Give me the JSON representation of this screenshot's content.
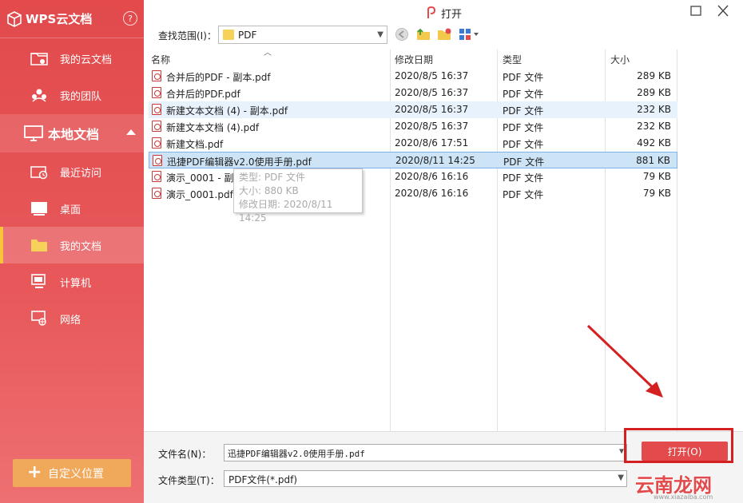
{
  "sidebar": {
    "brand": "WPS云文档",
    "help": "?",
    "items_top": [
      {
        "label": "我的云文档",
        "icon": "cloud-folder-icon"
      },
      {
        "label": "我的团队",
        "icon": "team-icon"
      }
    ],
    "section": "本地文档",
    "items_local": [
      {
        "label": "最近访问",
        "icon": "recent-icon"
      },
      {
        "label": "桌面",
        "icon": "desktop-icon"
      },
      {
        "label": "我的文档",
        "icon": "folder-icon"
      },
      {
        "label": "计算机",
        "icon": "computer-icon"
      },
      {
        "label": "网络",
        "icon": "network-icon"
      }
    ],
    "custom_button": "自定义位置"
  },
  "dialog": {
    "title": "打开",
    "look_in_label": "查找范围(I)：",
    "look_in_value": "PDF"
  },
  "columns": {
    "name": "名称",
    "date": "修改日期",
    "type": "类型",
    "size": "大小"
  },
  "files": [
    {
      "name": "合并后的PDF - 副本.pdf",
      "date": "2020/8/5 16:37",
      "type": "PDF 文件",
      "size": "289 KB"
    },
    {
      "name": "合并后的PDF.pdf",
      "date": "2020/8/5 16:37",
      "type": "PDF 文件",
      "size": "289 KB"
    },
    {
      "name": "新建文本文档 (4) - 副本.pdf",
      "date": "2020/8/5 16:37",
      "type": "PDF 文件",
      "size": "232 KB"
    },
    {
      "name": "新建文本文档 (4).pdf",
      "date": "2020/8/5 16:37",
      "type": "PDF 文件",
      "size": "232 KB"
    },
    {
      "name": "新建文档.pdf",
      "date": "2020/8/6 17:51",
      "type": "PDF 文件",
      "size": "492 KB"
    },
    {
      "name": "迅捷PDF编辑器v2.0使用手册.pdf",
      "date": "2020/8/11 14:25",
      "type": "PDF 文件",
      "size": "881 KB"
    },
    {
      "name": "演示_0001 - 副本.pdf",
      "date": "2020/8/6 16:16",
      "type": "PDF 文件",
      "size": "79 KB"
    },
    {
      "name": "演示_0001.pdf",
      "date": "2020/8/6 16:16",
      "type": "PDF 文件",
      "size": "79 KB"
    }
  ],
  "tooltip": {
    "line1": "类型: PDF 文件",
    "line2": "大小: 880 KB",
    "line3": "修改日期: 2020/8/11 14:25"
  },
  "footer": {
    "filename_label": "文件名(N)：",
    "filename_value": "迅捷PDF编辑器v2.0使用手册.pdf",
    "filetype_label": "文件类型(T)：",
    "filetype_value": "PDF文件(*.pdf)",
    "open_button": "打开(O)"
  },
  "watermark": {
    "text": "云南龙网",
    "sub": "www.xiazaiba.com"
  },
  "colors": {
    "accent": "#e24a4c",
    "annotation": "#d42020",
    "selection": "#cde4f7"
  }
}
